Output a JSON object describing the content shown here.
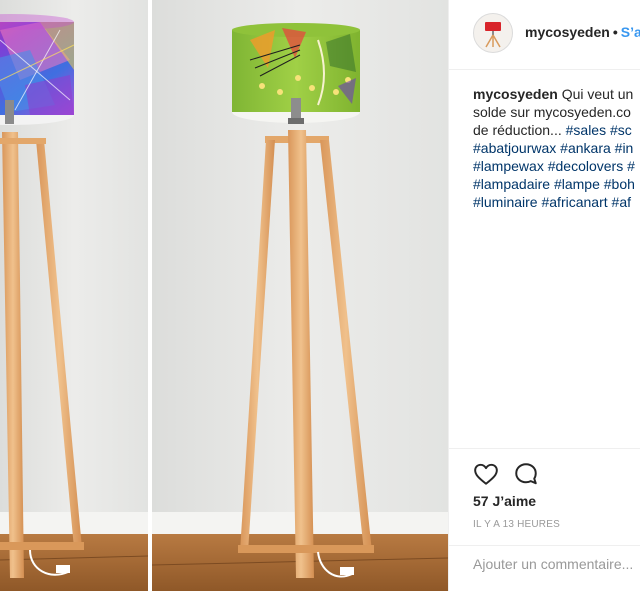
{
  "post": {
    "username": "mycosyeden",
    "follow_label": "S’abonner",
    "separator": "•",
    "caption": {
      "username": "mycosyeden",
      "line1": "Qui veut un",
      "line2": "solde sur mycosyeden.co",
      "line3_prefix": "de réduction...",
      "line3_tags": [
        "#sales",
        "#sc"
      ],
      "line4_tags": [
        "#abatjourwax",
        "#ankara",
        "#in"
      ],
      "line5_tags": [
        "#lampewax",
        "#decolovers",
        "#"
      ],
      "line6_tags": [
        "#lampadaire",
        "#lampe",
        "#boh"
      ],
      "line7_tags": [
        "#luminaire",
        "#africanart",
        "#af"
      ]
    },
    "likes_text": "57 J’aime",
    "timestamp": "IL Y A 13 HEURES",
    "comment_placeholder": "Ajouter un commentaire..."
  },
  "icons": {
    "like": "heart-icon",
    "comment": "comment-bubble-icon"
  },
  "colors": {
    "link_blue": "#3897f0",
    "hashtag": "#003569",
    "muted": "#999999",
    "lampshade_left": "#7a3fd0",
    "lampshade_right": "#8fc43a",
    "wood": "#e2a86a"
  }
}
